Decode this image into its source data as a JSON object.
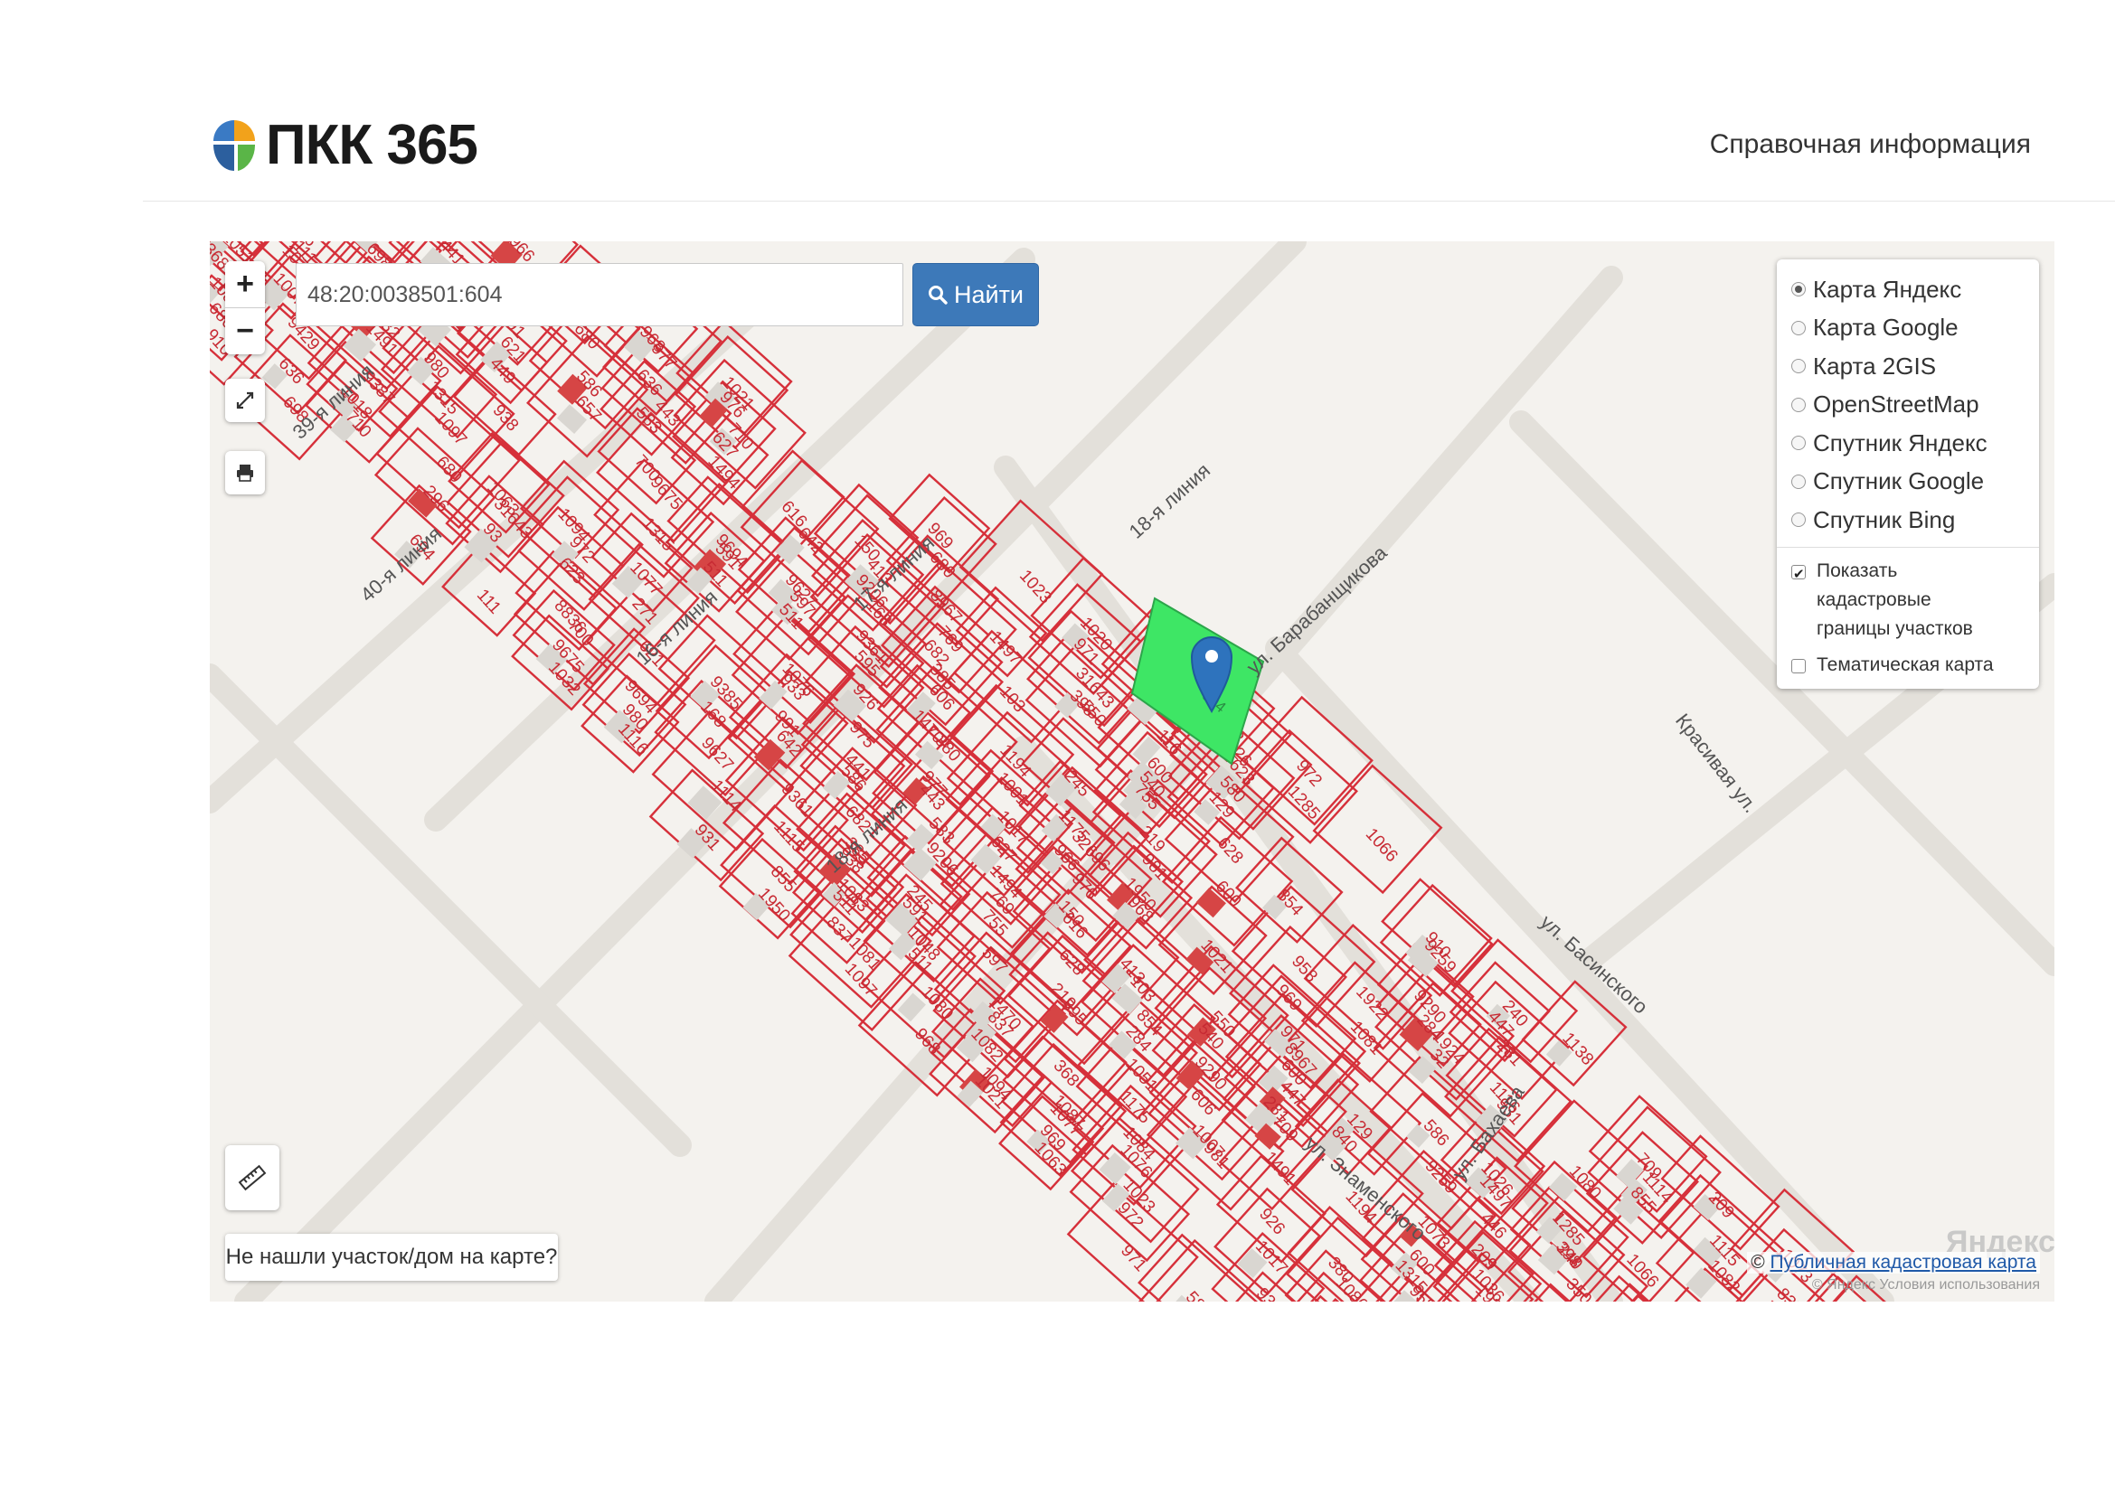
{
  "header": {
    "logo_text": "ПКК 365",
    "help_link": "Справочная информация"
  },
  "search": {
    "query": "48:20:0038501:604",
    "button_label": "Найти"
  },
  "map_controls": {
    "zoom_in": "+",
    "zoom_out": "−",
    "fullscreen_icon": "fullscreen-icon",
    "print_icon": "printer-icon",
    "ruler_icon": "ruler-icon"
  },
  "layers": {
    "base_maps": [
      {
        "label": "Карта Яндекс",
        "selected": true
      },
      {
        "label": "Карта Google",
        "selected": false
      },
      {
        "label": "Карта 2GIS",
        "selected": false
      },
      {
        "label": "OpenStreetMap",
        "selected": false
      },
      {
        "label": "Спутник Яндекс",
        "selected": false
      },
      {
        "label": "Спутник Google",
        "selected": false
      },
      {
        "label": "Спутник Bing",
        "selected": false
      }
    ],
    "overlays": [
      {
        "label": "Показать кадастровые границы участков",
        "checked": true
      },
      {
        "label": "Тематическая карта",
        "checked": false
      }
    ]
  },
  "map": {
    "street_labels": [
      "ул. Барабанщикова",
      "18-я линия",
      "Красивая ул.",
      "ул. Басинского",
      "ул. Бахаева",
      "ул. Знаменского",
      "16-я линия",
      "17-я линия",
      "40-я линия",
      "39-я линия"
    ],
    "selected_parcel": "604",
    "parcel_numbers": [
      "1017",
      "966",
      "968",
      "1021",
      "969",
      "1023",
      "1020",
      "1018",
      "1063",
      "972",
      "933",
      "975",
      "977",
      "976",
      "971",
      "586",
      "1026",
      "1285",
      "1066",
      "1285",
      "43",
      "680",
      "636",
      "710",
      "680",
      "31643",
      "623",
      "271",
      "441",
      "443",
      "627",
      "150",
      "8967",
      "1497",
      "398",
      "116",
      "580",
      "910",
      "296",
      "93",
      "9385",
      "991",
      "586",
      "583",
      "1494",
      "616",
      "413",
      "550",
      "600",
      "129",
      "9259",
      "240",
      "1138",
      "698",
      "8836",
      "621",
      "642",
      "9206",
      "769",
      "103",
      "540",
      "447",
      "840",
      "446",
      "350",
      "644",
      "449",
      "657",
      "700",
      "168",
      "682",
      "755",
      "628",
      "854",
      "9290",
      "281",
      "209",
      "373",
      "694",
      "111",
      "9675",
      "9694",
      "9627",
      "9361",
      "385",
      "245",
      "219",
      "284",
      "709",
      "1073",
      "1036",
      "1072",
      "1032",
      "980",
      "938",
      "591",
      "597",
      "595",
      "606",
      "1194",
      "600",
      "1922",
      "1924",
      "1116",
      "1114",
      "1115",
      "1083",
      "1048",
      "1051",
      "1007",
      "1491",
      "1315",
      "1315",
      "511",
      "511",
      "1470",
      "1175",
      "981",
      "958",
      "32",
      "931",
      "855",
      "837",
      "837",
      "368",
      "926",
      "380",
      "1001",
      "32696",
      "1950",
      "1081",
      "1080",
      "1082",
      "1087",
      "1084",
      "1086",
      "9429",
      "9387",
      "1097",
      "1094",
      "1077",
      "1076"
    ],
    "watermark": "Яндекс"
  },
  "bottom": {
    "not_found_label": "Не нашли участок/дом на карте?",
    "attribution_prefix": "©",
    "attribution_link": "Публичная кадастровая карта",
    "attribution_sub": "© Яндекс Условия использования"
  },
  "colors": {
    "parcel_border": "#d6303a",
    "selected_parcel_fill": "#3ee665",
    "search_button": "#3d79b9",
    "marker": "#2e73bd"
  }
}
